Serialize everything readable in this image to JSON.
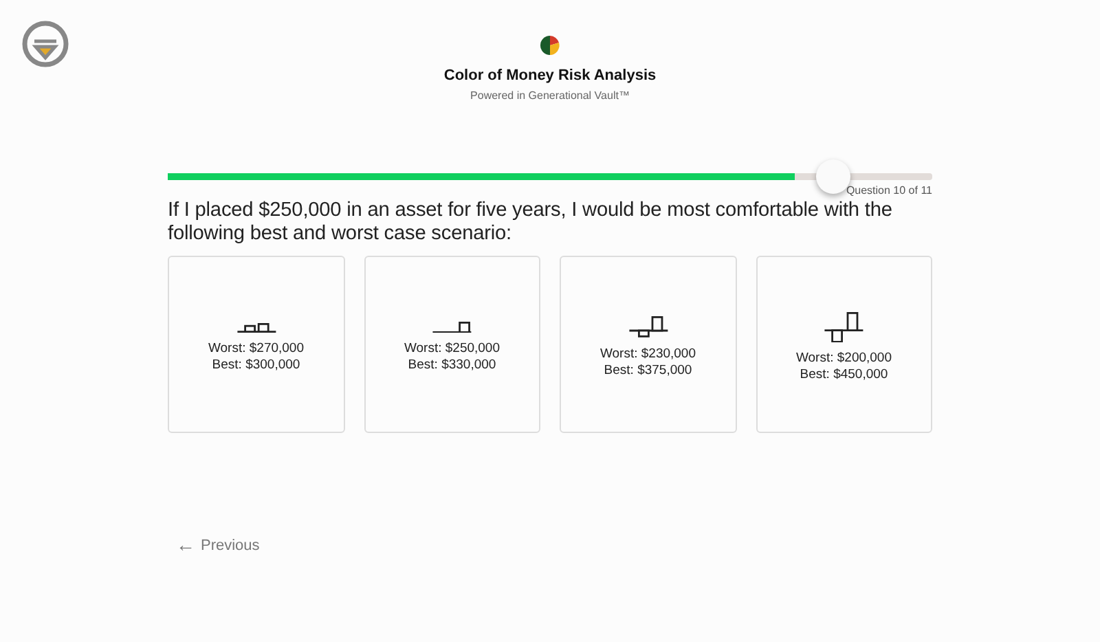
{
  "header": {
    "title": "Color of Money Risk Analysis",
    "subtitle": "Powered in Generational Vault™"
  },
  "progress": {
    "level": 0.82,
    "label": "Question 10 of 11"
  },
  "question": "If I placed $250,000 in an asset for five years, I would be most comfortable with the following best and worst case scenario:",
  "options": [
    {
      "worst": "Worst: $270,000",
      "best": "Best: $300,000"
    },
    {
      "worst": "Worst: $250,000",
      "best": "Best: $330,000"
    },
    {
      "worst": "Worst: $230,000",
      "best": "Best: $375,000"
    },
    {
      "worst": "Worst: $200,000",
      "best": "Best: $450,000"
    }
  ],
  "previous": {
    "label": "Previous",
    "icon": "←"
  }
}
